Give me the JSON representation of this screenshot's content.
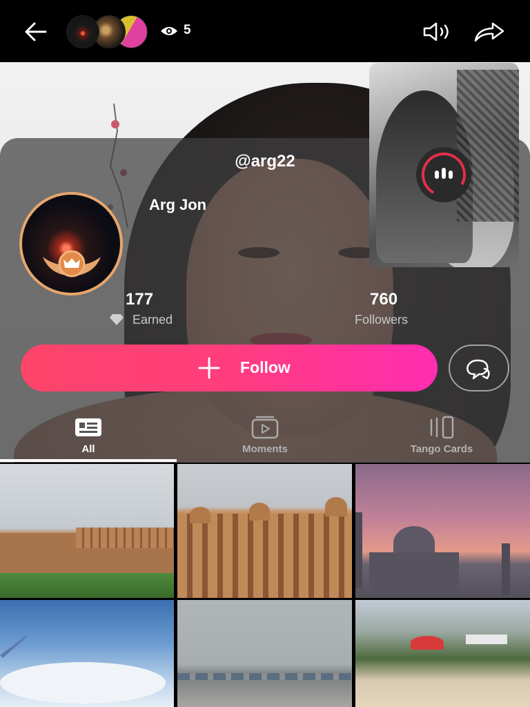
{
  "top_bar": {
    "viewer_count": "5",
    "icons": [
      "arrow-left-icon",
      "eye-icon",
      "speaker-icon",
      "share-icon"
    ]
  },
  "profile": {
    "handle": "@arg22",
    "name": "Arg Jon",
    "stats": [
      {
        "value": "177",
        "label": "Earned"
      },
      {
        "value": "760",
        "label": "Followers"
      }
    ],
    "follow_label": "Follow"
  },
  "tabs": [
    {
      "label": "All",
      "active": true
    },
    {
      "label": "Moments",
      "active": false
    },
    {
      "label": "Tango Cards",
      "active": false
    }
  ],
  "gallery": {
    "items": [
      {
        "subject": "hill fort and green lawn"
      },
      {
        "subject": "sandstone palace facade"
      },
      {
        "subject": "taj mahal at sunset"
      },
      {
        "subject": "sky seen from airplane window"
      },
      {
        "subject": "airport runway"
      },
      {
        "subject": "goa beach sign"
      }
    ]
  },
  "colors": {
    "follow_gradient_start": "#ff4569",
    "follow_gradient_end": "#ff2db0",
    "avatar_ring": "#e7a66c",
    "live_ring": "#e0304a"
  }
}
